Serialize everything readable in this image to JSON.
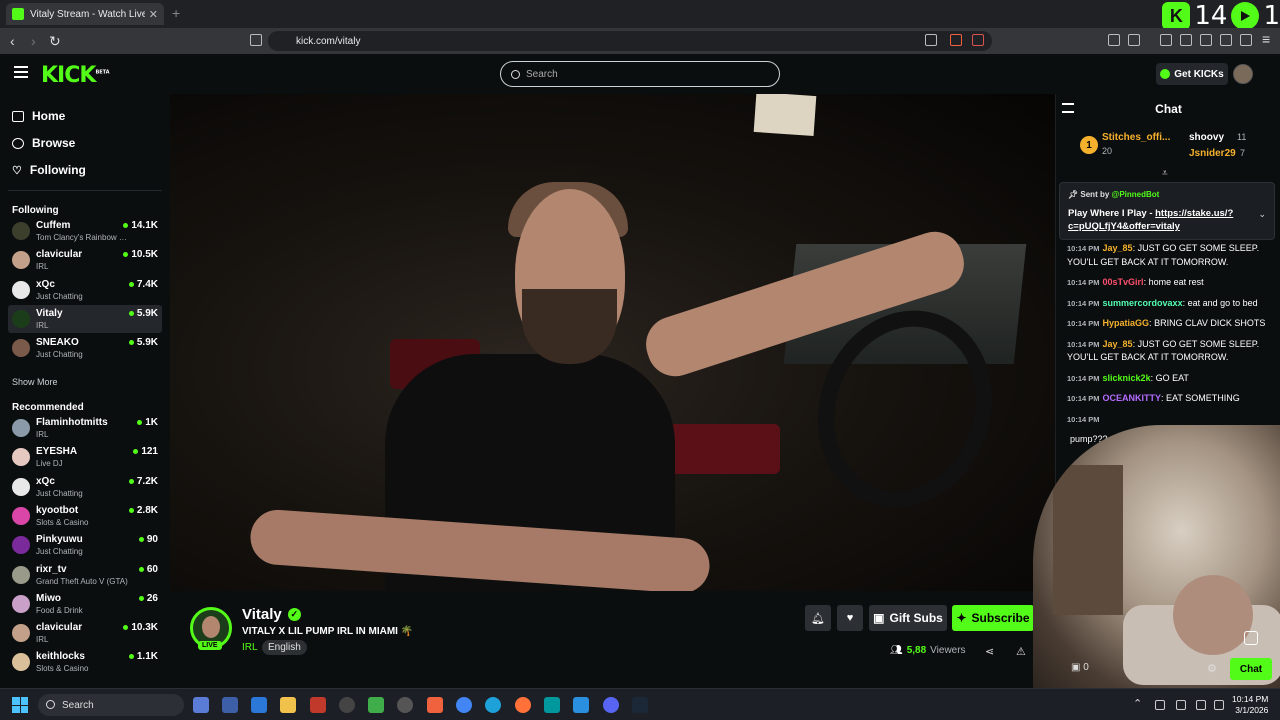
{
  "browser": {
    "tab_title": "Vitaly Stream - Watch Live on Kick",
    "url": "kick.com/vitaly",
    "overlay_count_left": "14",
    "overlay_count_right": "1"
  },
  "header": {
    "logo": "KICK",
    "logo_badge": "BETA",
    "search_placeholder": "Search",
    "get_kicks_label": "Get KICKs"
  },
  "sidebar": {
    "nav": [
      {
        "label": "Home",
        "icon": "home-icon"
      },
      {
        "label": "Browse",
        "icon": "compass-icon"
      },
      {
        "label": "Following",
        "icon": "heart-icon"
      }
    ],
    "following_title": "Following",
    "following": [
      {
        "name": "Cuffem",
        "category": "Tom Clancy's Rainbow Six Siege",
        "viewers": "14.1K",
        "color": "#3b3f2c"
      },
      {
        "name": "clavicular",
        "category": "IRL",
        "viewers": "10.5K",
        "color": "#c2a089"
      },
      {
        "name": "xQc",
        "category": "Just Chatting",
        "viewers": "7.4K",
        "color": "#e8e8e8"
      },
      {
        "name": "Vitaly",
        "category": "IRL",
        "viewers": "5.9K",
        "color": "#1c3d1a"
      },
      {
        "name": "SNEAKO",
        "category": "Just Chatting",
        "viewers": "5.9K",
        "color": "#7a5a4a"
      }
    ],
    "show_more": "Show More",
    "recommended_title": "Recommended",
    "recommended": [
      {
        "name": "Flaminhotmitts",
        "category": "IRL",
        "viewers": "1K",
        "color": "#8b9aa8"
      },
      {
        "name": "EYESHA",
        "category": "Live DJ",
        "viewers": "121",
        "color": "#e5c8c0"
      },
      {
        "name": "xQc",
        "category": "Just Chatting",
        "viewers": "7.2K",
        "color": "#e8e8e8"
      },
      {
        "name": "kyootbot",
        "category": "Slots & Casino",
        "viewers": "2.8K",
        "color": "#d946a8"
      },
      {
        "name": "Pinkyuwu",
        "category": "Just Chatting",
        "viewers": "90",
        "color": "#7a2a9a"
      },
      {
        "name": "rixr_tv",
        "category": "Grand Theft Auto V (GTA)",
        "viewers": "60",
        "color": "#9a9a8a"
      },
      {
        "name": "Miwo",
        "category": "Food & Drink",
        "viewers": "26",
        "color": "#c9a0c8"
      },
      {
        "name": "clavicular",
        "category": "IRL",
        "viewers": "10.3K",
        "color": "#c2a089"
      },
      {
        "name": "keithlocks",
        "category": "Slots & Casino",
        "viewers": "1.1K",
        "color": "#d9c09a"
      }
    ]
  },
  "stream": {
    "channel": "Vitaly",
    "live_label": "LIVE",
    "title": "VITALY X LIL PUMP IRL IN MIAMI 🌴",
    "category": "IRL",
    "language": "English",
    "gift_subs_label": "Gift Subs",
    "subscribe_label": "Subscribe",
    "viewers_count": "5,88",
    "viewers_label": "Viewers"
  },
  "chat": {
    "title": "Chat",
    "leaderboard": [
      {
        "name": "Stitches_offi...",
        "count": "20",
        "rank": "1"
      },
      {
        "name": "shoovy",
        "count": "11"
      },
      {
        "name": "Jsnider29",
        "count": "7"
      }
    ],
    "pinned": {
      "sent_by_label": "Sent by",
      "sent_by": "@PinnedBot",
      "text_prefix": "Play Where I Play - ",
      "link": "https://stake.us/?c=pUQLfjY4&offer=vitaly"
    },
    "messages": [
      {
        "time": "10:14 PM",
        "user": "Jay_85",
        "color": "#f5b12d",
        "text": "JUST GO GET SOME SLEEP. YOU'LL GET BACK AT IT TOMORROW."
      },
      {
        "time": "10:14 PM",
        "user": "00sTvGirl",
        "color": "#ff4f6d",
        "text": "home eat rest"
      },
      {
        "time": "10:14 PM",
        "user": "summercordovaxx",
        "color": "#53fcb1",
        "text": "eat and go to bed"
      },
      {
        "time": "10:14 PM",
        "user": "HypatiaGG",
        "color": "#f5b12d",
        "text": "BRING CLAV DICK SHOTS"
      },
      {
        "time": "10:14 PM",
        "user": "Jay_85",
        "color": "#f5b12d",
        "text": "JUST GO GET SOME SLEEP. YOU'LL GET BACK AT IT TOMORROW."
      },
      {
        "time": "10:14 PM",
        "user": "slicknick2k",
        "color": "#53fc18",
        "text": "GO EAT"
      },
      {
        "time": "10:14 PM",
        "user": "OCEANKITTY",
        "color": "#b46bff",
        "text": "EAT SOMETHING"
      },
      {
        "time": "10:14 PM",
        "user": "",
        "color": "#7f8fa0",
        "text": ""
      },
      {
        "time": "",
        "user": "",
        "color": "#f5b12d",
        "text": "pump???"
      }
    ],
    "gift_count": "0",
    "chat_button": "Chat"
  },
  "taskbar": {
    "search_label": "Search",
    "time": "10:14 PM",
    "date": "3/1/2026"
  }
}
